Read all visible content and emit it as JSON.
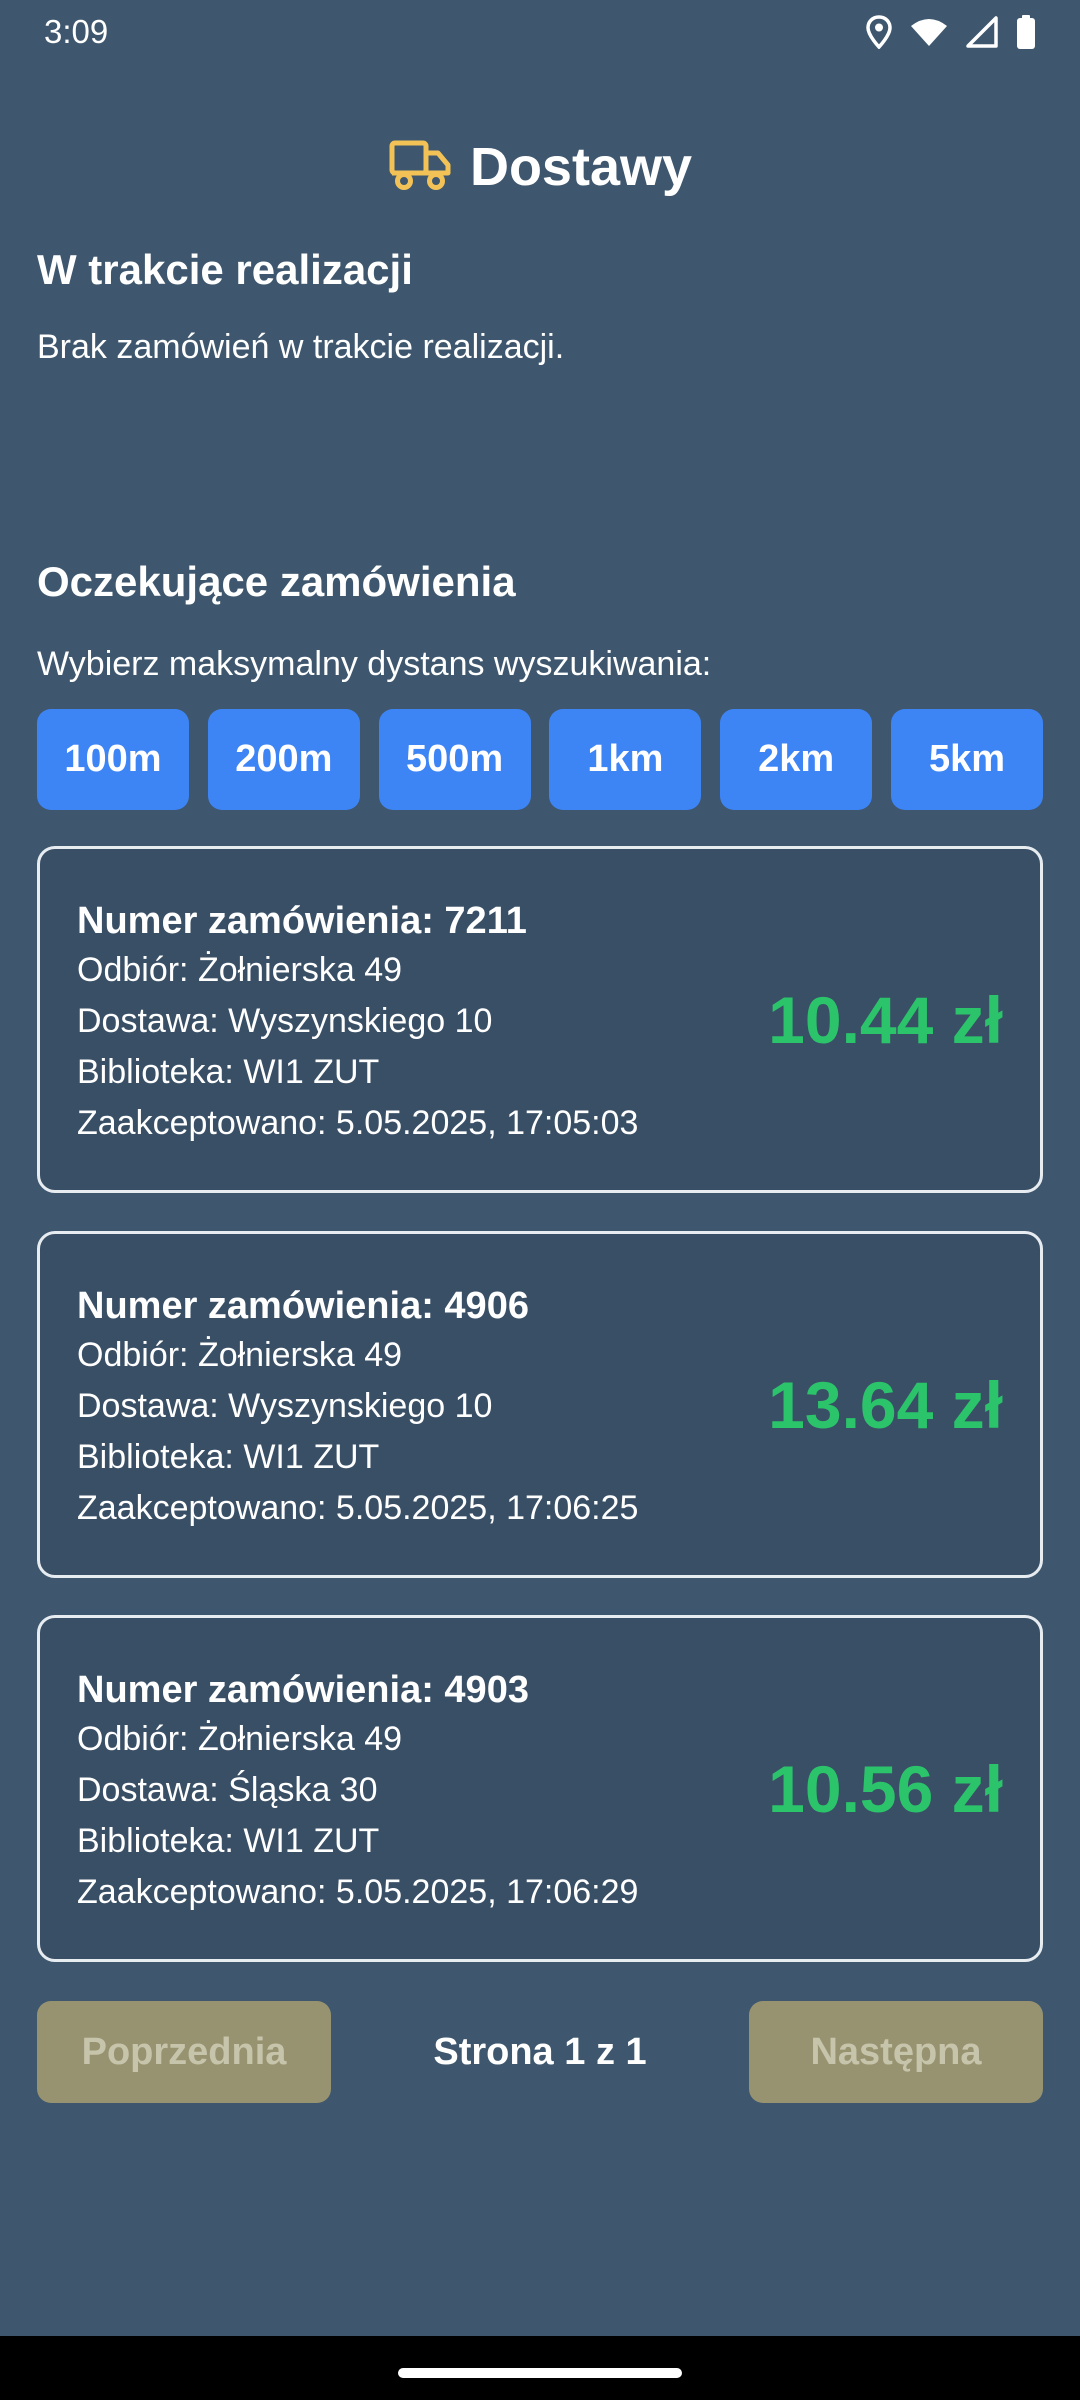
{
  "status_bar": {
    "time": "3:09",
    "icons": [
      "location-icon",
      "wifi-icon",
      "signal-icon",
      "battery-icon"
    ]
  },
  "header": {
    "icon": "truck-icon",
    "title": "Dostawy"
  },
  "in_progress": {
    "title": "W trakcie realizacji",
    "empty_text": "Brak zamówień w trakcie realizacji."
  },
  "pending": {
    "title": "Oczekujące zamówienia",
    "distance_prompt": "Wybierz maksymalny dystans wyszukiwania:",
    "distances": [
      "100m",
      "200m",
      "500m",
      "1km",
      "2km",
      "5km"
    ]
  },
  "orders": [
    {
      "number": "Numer zamówienia: 7211",
      "pickup": "Odbiór: Żołnierska 49",
      "delivery": "Dostawa: Wyszynskiego 10",
      "library": "Biblioteka: WI1 ZUT",
      "accepted": "Zaakceptowano: 5.05.2025, 17:05:03",
      "price": "10.44 zł"
    },
    {
      "number": "Numer zamówienia: 4906",
      "pickup": "Odbiór: Żołnierska 49",
      "delivery": "Dostawa: Wyszynskiego 10",
      "library": "Biblioteka: WI1 ZUT",
      "accepted": "Zaakceptowano: 5.05.2025, 17:06:25",
      "price": "13.64 zł"
    },
    {
      "number": "Numer zamówienia: 4903",
      "pickup": "Odbiór: Żołnierska 49",
      "delivery": "Dostawa: Śląska 30",
      "library": "Biblioteka: WI1 ZUT",
      "accepted": "Zaakceptowano: 5.05.2025, 17:06:29",
      "price": "10.56 zł"
    }
  ],
  "pagination": {
    "prev_label": "Poprzednia",
    "page_text": "Strona 1 z 1",
    "next_label": "Następna"
  },
  "colors": {
    "background": "#3e576e",
    "card": "#394f66",
    "accent_blue": "#3d84f5",
    "price_green": "#2cc46a",
    "disabled_button": "#979370",
    "truck_icon": "#f3c257"
  }
}
